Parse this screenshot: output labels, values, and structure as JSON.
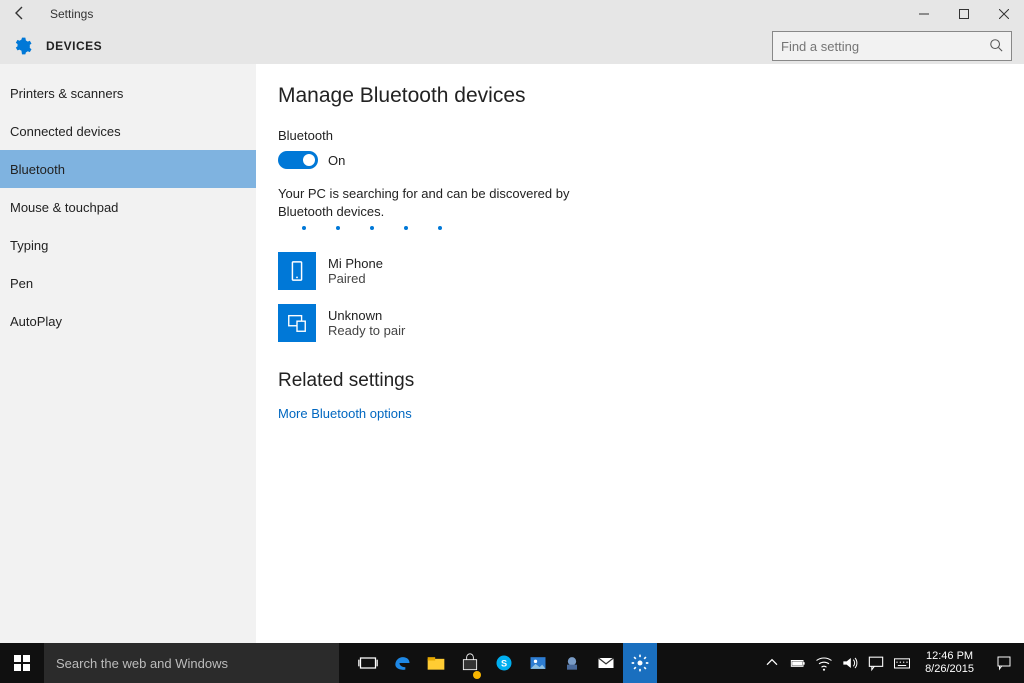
{
  "window": {
    "title": "Settings",
    "section": "DEVICES"
  },
  "search": {
    "placeholder": "Find a setting"
  },
  "sidebar": {
    "items": [
      {
        "label": "Printers & scanners"
      },
      {
        "label": "Connected devices"
      },
      {
        "label": "Bluetooth"
      },
      {
        "label": "Mouse & touchpad"
      },
      {
        "label": "Typing"
      },
      {
        "label": "Pen"
      },
      {
        "label": "AutoPlay"
      }
    ],
    "active_index": 2
  },
  "main": {
    "heading": "Manage Bluetooth devices",
    "bt_label": "Bluetooth",
    "toggle_state": "On",
    "status_text": "Your PC is searching for and can be discovered by Bluetooth devices.",
    "devices": [
      {
        "name": "Mi Phone",
        "status": "Paired",
        "icon": "phone"
      },
      {
        "name": "Unknown",
        "status": "Ready to pair",
        "icon": "pc"
      }
    ],
    "related_heading": "Related settings",
    "related_link": "More Bluetooth options"
  },
  "taskbar": {
    "search_placeholder": "Search the web and Windows",
    "time": "12:46 PM",
    "date": "8/26/2015"
  }
}
